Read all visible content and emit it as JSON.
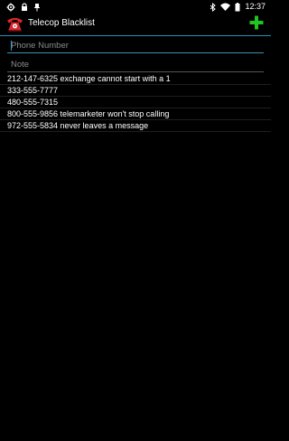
{
  "status_bar": {
    "time": "12:37"
  },
  "action_bar": {
    "title": "Telecop Blacklist",
    "add_icon": "plus-icon",
    "app_icon": "red-telephone-icon"
  },
  "form": {
    "phone_placeholder": "Phone Number",
    "phone_value": "",
    "note_placeholder": "Note",
    "note_value": ""
  },
  "blacklist": [
    "212-147-6325 exchange cannot start with a 1",
    "333-555-7777",
    "480-555-7315",
    "800-555-9856 telemarketer won't stop calling",
    "972-555-5834 never leaves a message"
  ],
  "colors": {
    "accent": "#2c8fb3",
    "add": "#22c422",
    "phone_icon": "#d8262b"
  }
}
